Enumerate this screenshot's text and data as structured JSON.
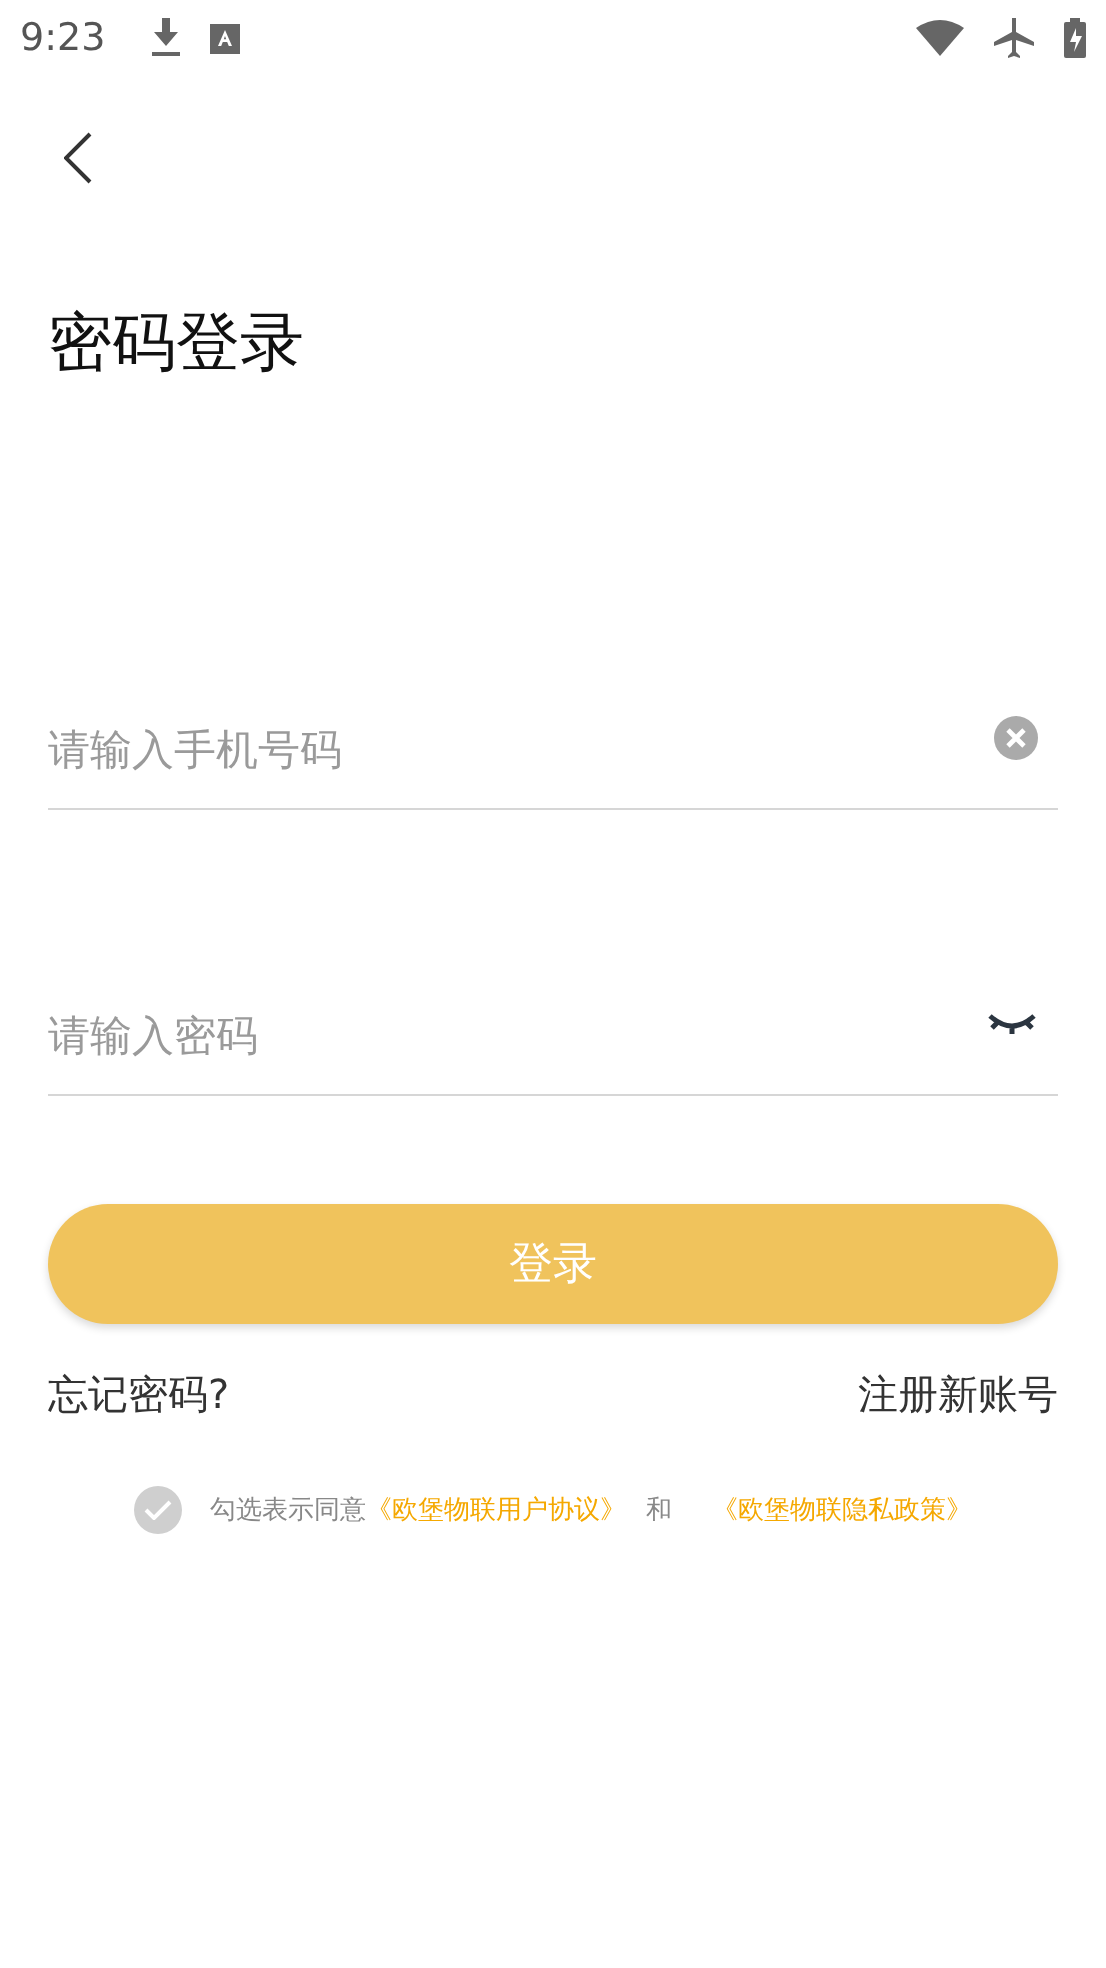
{
  "status_bar": {
    "time": "9:23"
  },
  "title": "密码登录",
  "phone_field": {
    "placeholder": "请输入手机号码"
  },
  "password_field": {
    "placeholder": "请输入密码",
    "visible": false
  },
  "login_button": "登录",
  "forgot_link": "忘记密码?",
  "register_link": "注册新账号",
  "agreement": {
    "checked": false,
    "prefix": "勾选表示同意",
    "user_agreement": "《欧堡物联用户协议》",
    "conjunction": "和",
    "privacy_policy": "《欧堡物联隐私政策》"
  }
}
